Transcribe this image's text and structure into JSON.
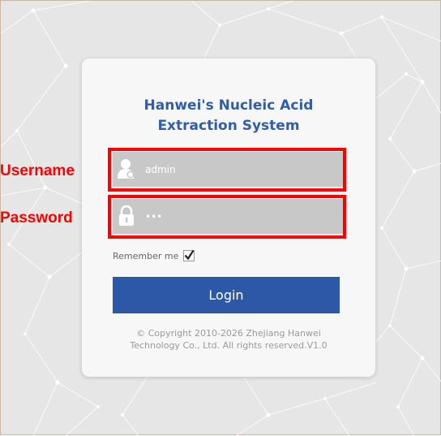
{
  "login": {
    "title_line1": "Hanwei's Nucleic Acid",
    "title_line2": "Extraction System",
    "username_value": "admin",
    "password_value": "•••",
    "remember_label": "Remember me",
    "remember_checked": true,
    "login_button": "Login",
    "copyright_line1": "© Copyright 2010-2026 Zhejiang Hanwei",
    "copyright_line2": "Technology Co., Ltd. All rights reserved.V1.0"
  },
  "annotations": {
    "username_label": "Username",
    "password_label": "Password"
  },
  "icons": {
    "username": "user-icon",
    "password": "lock-icon",
    "remember": "checkmark-icon"
  },
  "colors": {
    "accent": "#2d58a8",
    "title": "#2f5eae",
    "annotation": "#ff0000",
    "field_bg": "#c8c8c8"
  }
}
